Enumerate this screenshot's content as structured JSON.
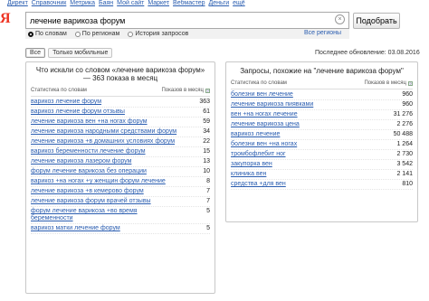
{
  "topnav": [
    "Директ",
    "Справочник",
    "Метрика",
    "Баян",
    "Мой сайт",
    "Маркет",
    "Вебмастер",
    "Деньги",
    "ещё"
  ],
  "logo": "Я",
  "search": {
    "value": "лечение варикоза форум",
    "button": "Подобрать"
  },
  "radios": [
    {
      "label": "По словам",
      "selected": true
    },
    {
      "label": "По регионам",
      "selected": false
    },
    {
      "label": "История запросов",
      "selected": false
    }
  ],
  "all_regions": "Все регионы",
  "tabs": [
    {
      "label": "Все",
      "active": true
    },
    {
      "label": "Только мобильные",
      "active": false
    }
  ],
  "last_update": "Последнее обновление: 03.08.2016",
  "left": {
    "title": "Что искали со словом «лечение варикоза форум» — 363 показа в месяц",
    "col_query": "Статистика по словам",
    "col_count": "Показов в месяц",
    "rows": [
      {
        "q": "варикоз лечение форум",
        "n": "363"
      },
      {
        "q": "варикоз лечение форум отзывы",
        "n": "61"
      },
      {
        "q": "лечение варикоза вен +на ногах форум",
        "n": "59"
      },
      {
        "q": "лечение варикоза народными средствами форум",
        "n": "34"
      },
      {
        "q": "лечение варикоза +в домашних условиях форум",
        "n": "22"
      },
      {
        "q": "варикоз беременности лечение форум",
        "n": "15"
      },
      {
        "q": "лечение варикоза лазером форум",
        "n": "13"
      },
      {
        "q": "форум лечение варикоза без операции",
        "n": "10"
      },
      {
        "q": "варикоз +на ногах +у женщин форум лечение",
        "n": "8"
      },
      {
        "q": "лечение варикоза +в кемерово форум",
        "n": "7"
      },
      {
        "q": "лечение варикоза форум врачей отзывы",
        "n": "7"
      },
      {
        "q": "форум лечение варикоза +во время беременности",
        "n": "5"
      },
      {
        "q": "варикоз матки лечение форум",
        "n": "5"
      }
    ]
  },
  "right": {
    "title": "Запросы, похожие на \"лечение варикоза форум\"",
    "col_query": "Статистика по словам",
    "col_count": "Показов в месяц",
    "rows": [
      {
        "q": "болезни вен лечение",
        "n": "960"
      },
      {
        "q": "лечение варикоза пиявками",
        "n": "960"
      },
      {
        "q": "вен +на ногах лечение",
        "n": "31 276"
      },
      {
        "q": "лечение варикоза цена",
        "n": "2 276"
      },
      {
        "q": "варикоз лечение",
        "n": "50 488"
      },
      {
        "q": "болезни вен +на ногах",
        "n": "1 264"
      },
      {
        "q": "тромбофлебит ног",
        "n": "2 730"
      },
      {
        "q": "закупорка вен",
        "n": "3 542"
      },
      {
        "q": "клиника вен",
        "n": "2 141"
      },
      {
        "q": "средства +для вен",
        "n": "810"
      }
    ]
  }
}
